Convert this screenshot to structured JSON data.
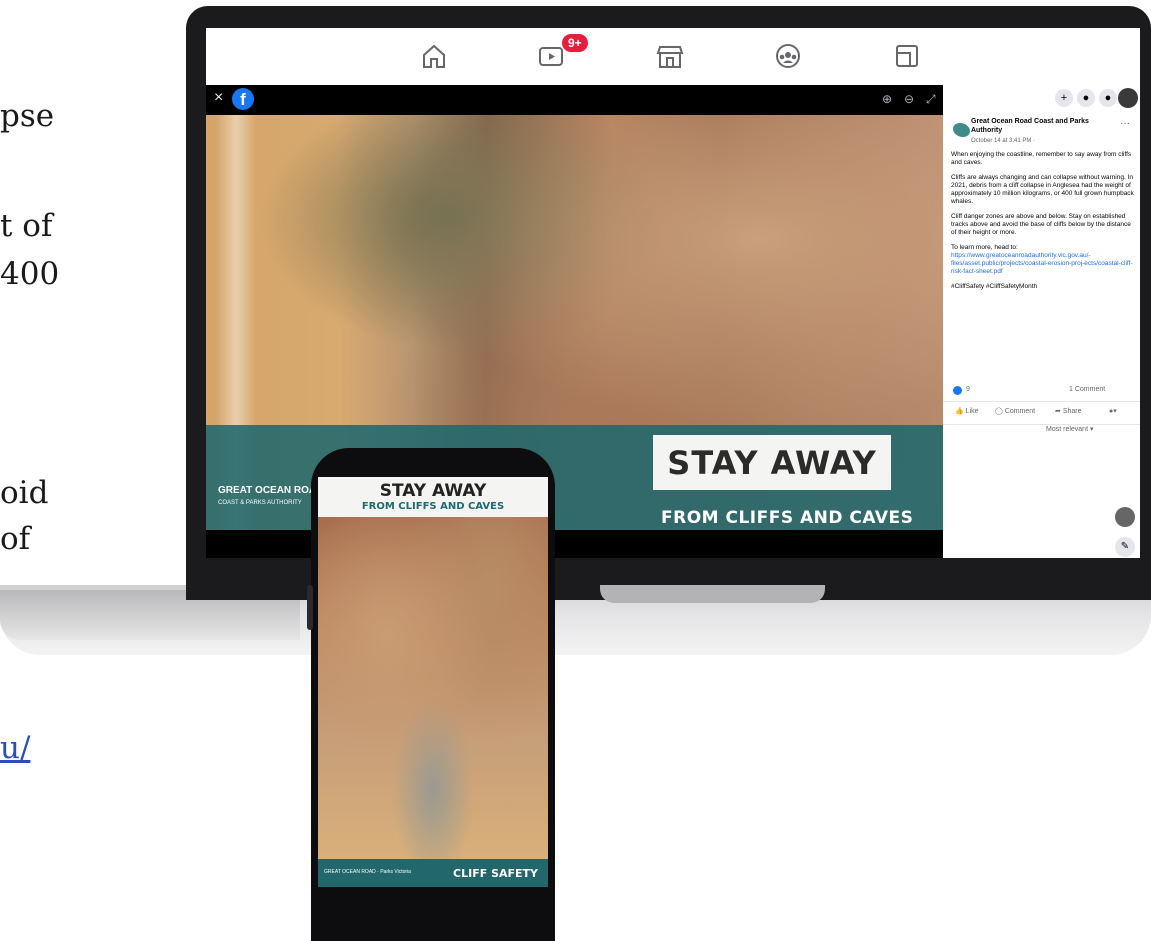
{
  "background_text": {
    "line1": "pse",
    "line2": "t of",
    "line3": "400",
    "line4": "oid",
    "line5": "of",
    "link": "u/"
  },
  "facebook_nav": {
    "icons": [
      "home-icon",
      "watch-icon",
      "marketplace-icon",
      "groups-icon",
      "gaming-icon"
    ],
    "watch_badge": "9+"
  },
  "viewer": {
    "close_label": "×",
    "facebook_logo": "f",
    "zoom_in": "⊕",
    "zoom_out": "⊖",
    "fullscreen": "⤢",
    "banner_title": "STAY AWAY",
    "banner_subtitle": "FROM CLIFFS AND CAVES",
    "org_logo_line1": "GREAT OCEAN ROAD",
    "org_logo_line2": "COAST & PARKS AUTHORITY"
  },
  "post": {
    "author": "Great Ocean Road Coast and Parks Authority",
    "date": "October 14 at 3:41 PM · ",
    "more": "···",
    "p1": "When enjoying the coastline, remember to say away from cliffs and caves.",
    "p2": "Cliffs are always changing and can collapse without warning. In 2021, debris from a cliff collapse in Anglesea had the weight of approximately 10 million kilograms, or 400 full grown humpback whales.",
    "p3": "Cliff danger zones are above and below. Stay on established tracks above and avoid the base of cliffs below by the distance of their height or more.",
    "p4": "To learn more, head to:",
    "url": "https://www.greatoceanroadauthority.vic.gov.au/-files/asset.public/projects/coastal-erosion-proj-ects/coastal-cliff-risk-fact-sheet.pdf",
    "hashtags": "#CliffSafety #CliffSafetyMonth",
    "reactions": "9",
    "comments": "1 Comment",
    "like": "Like",
    "comment": "Comment",
    "share": "Share",
    "sort": "Most relevant ▾"
  },
  "top_actions": [
    "+",
    "●",
    "●"
  ],
  "phone": {
    "title": "STAY AWAY",
    "subtitle": "FROM CLIFFS AND CAVES",
    "footer": "CLIFF SAFETY",
    "logos": "GREAT OCEAN ROAD · Parks Victoria"
  }
}
